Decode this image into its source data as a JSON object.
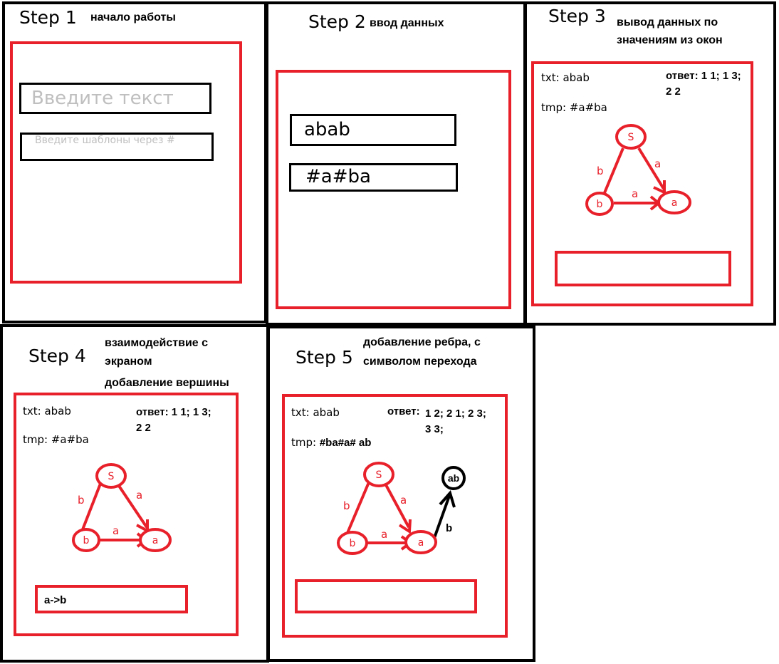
{
  "colors": {
    "accent_red": "#e8202a",
    "border_black": "#000000"
  },
  "step1": {
    "title": "Step 1",
    "description": "начало работы",
    "text_input_placeholder": "Введите текст",
    "template_input_placeholder": "Введите шаблоны через #"
  },
  "step2": {
    "title": "Step 2",
    "description": "ввод данных",
    "text_input_value": "abab",
    "template_input_value": "#a#ba"
  },
  "step3": {
    "title": "Step 3",
    "description_line1": "вывод данных по",
    "description_line2": "значениям из окон",
    "txt": "txt: abab",
    "tmp": "tmp: #a#ba",
    "answer_line1": "ответ: 1 1; 1 3;",
    "answer_line2": "2 2",
    "graph": {
      "nodes": [
        "S",
        "b",
        "a"
      ],
      "edges": [
        {
          "from": "S",
          "to": "b",
          "label": "b"
        },
        {
          "from": "S",
          "to": "a",
          "label": "a"
        },
        {
          "from": "b",
          "to": "a",
          "label": "a"
        }
      ]
    },
    "input_value": ""
  },
  "step4": {
    "title": "Step 4",
    "description_line1": "взаимодействие с",
    "description_line2": "экраном",
    "description_line3": "добавление вершины",
    "txt": "txt: abab",
    "tmp": "tmp: #a#ba",
    "answer_line1": "ответ: 1 1; 1 3;",
    "answer_line2": "2 2",
    "graph": {
      "nodes": [
        "S",
        "b",
        "a"
      ],
      "edges": [
        {
          "from": "S",
          "to": "b",
          "label": "b"
        },
        {
          "from": "S",
          "to": "a",
          "label": "a"
        },
        {
          "from": "b",
          "to": "a",
          "label": "a"
        }
      ]
    },
    "input_value": "a->b"
  },
  "step5": {
    "title": "Step 5",
    "description_line1": "добавление ребра, с",
    "description_line2": "символом перехода",
    "txt": "txt: abab",
    "tmp_prefix": "tmp: ",
    "tmp_value": "#ba#a# ab",
    "answer_label": "ответ:",
    "answer_line1": "1 2; 2 1; 2 3;",
    "answer_line2": "3 3;",
    "graph": {
      "nodes": [
        "S",
        "b",
        "a",
        "ab"
      ],
      "edges": [
        {
          "from": "S",
          "to": "b",
          "label": "b"
        },
        {
          "from": "S",
          "to": "a",
          "label": "a"
        },
        {
          "from": "b",
          "to": "a",
          "label": "a"
        },
        {
          "from": "a",
          "to": "ab",
          "label": "b"
        }
      ]
    },
    "input_value": ""
  }
}
